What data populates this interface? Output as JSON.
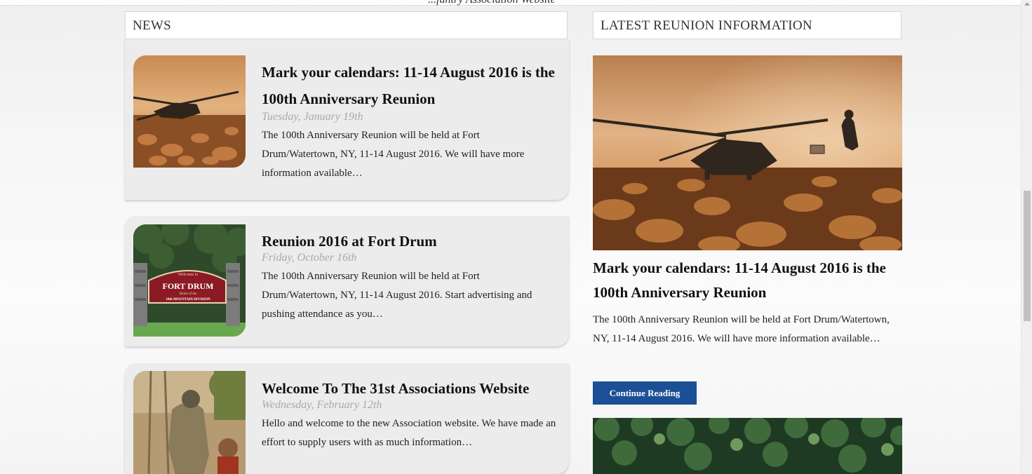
{
  "header": {
    "tagline": "...fantry Association Website"
  },
  "news": {
    "heading": "NEWS",
    "items": [
      {
        "title": "Mark your calendars: 11-14 August 2016 is the 100th Anniversary Reunion",
        "date": "Tuesday, January 19th",
        "excerpt": "The 100th Anniversary Reunion will be held at Fort Drum/Watertown, NY, 11-14 August 2016. We will have more information available…",
        "image": "helicopter-photo"
      },
      {
        "title": "Reunion 2016 at Fort Drum",
        "date": "Friday, October 16th",
        "excerpt": "The 100th Anniversary Reunion will be held at Fort Drum/Watertown, NY, 11-14 August 2016. Start advertising and pushing attendance as you…",
        "image": "fort-drum-sign-photo",
        "sign_text": {
          "welcome": "Welcome to",
          "name": "FORT DRUM",
          "home": "Home of the",
          "division": "10th MOUNTAIN DIVISION"
        }
      },
      {
        "title": "Welcome To The 31st Associations Website",
        "date": "Wednesday, February 12th",
        "excerpt": "Hello and welcome to the new Association website. We have made an effort to supply users with as much information…",
        "image": "soldier-photo"
      }
    ]
  },
  "reunion": {
    "heading": "LATEST REUNION INFORMATION",
    "title": "Mark your calendars: 11-14 August 2016 is the 100th Anniversary Reunion",
    "excerpt": "The 100th Anniversary Reunion will be held at Fort Drum/Watertown, NY, 11-14 August 2016. We will have more information available…",
    "button_label": "Continue Reading",
    "button_color": "#1b4f96"
  }
}
